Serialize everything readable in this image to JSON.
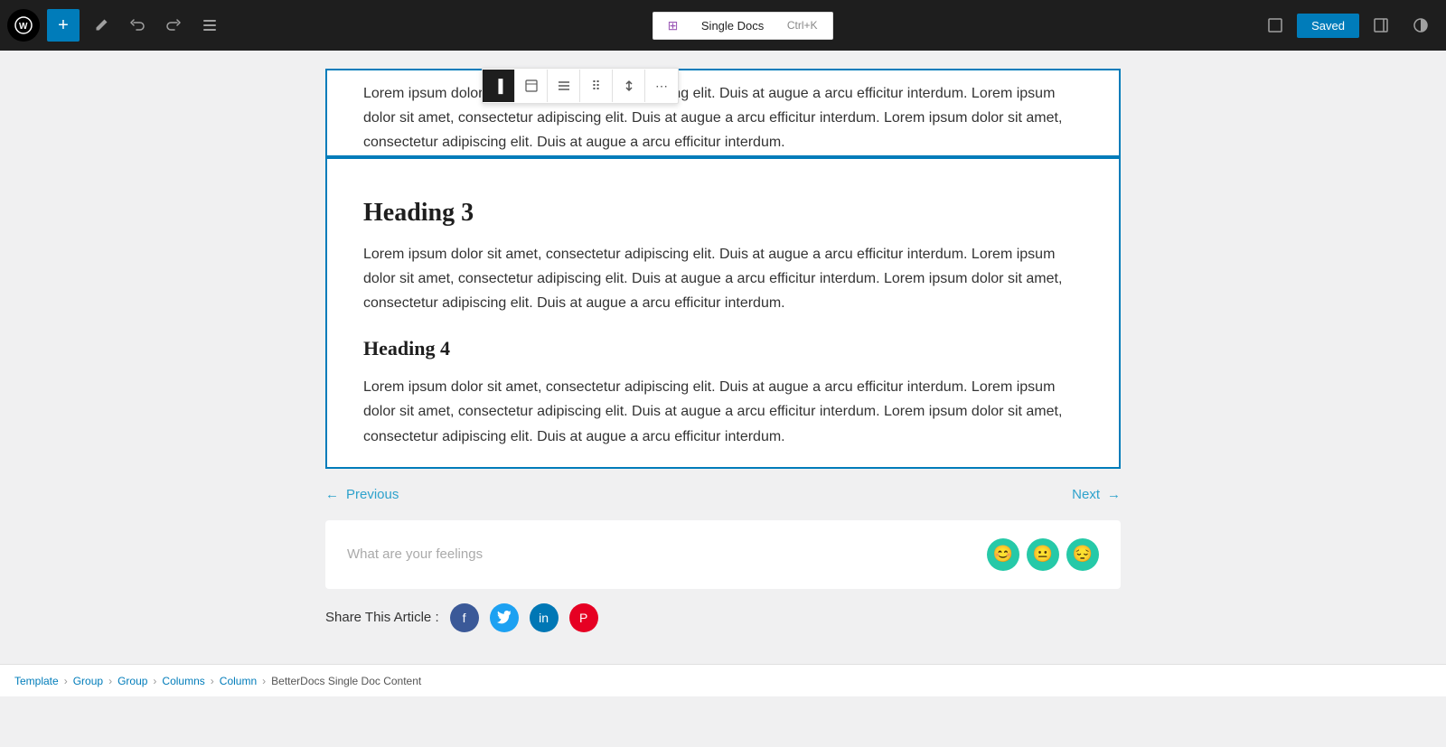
{
  "toolbar": {
    "add_block_label": "+",
    "edit_label": "✏",
    "undo_label": "←",
    "redo_label": "→",
    "list_view_label": "≡",
    "single_docs_label": "Single Docs",
    "shortcut_label": "Ctrl+K",
    "saved_label": "Saved",
    "view_icon": "▭",
    "sidebar_icon": "▣",
    "contrast_icon": "◑"
  },
  "block_toolbar": {
    "sidebar_btn": "▐",
    "block_type": "B",
    "align_btn": "≡",
    "drag_btn": "⠿",
    "move_btn": "⇅",
    "more_btn": "⋯"
  },
  "content": {
    "top_paragraph": "Lorem ipsum dolor sit amet, consectetur adipiscing elit. Duis at augue a arcu efficitur interdum. Lorem ipsum dolor sit amet, consectetur adipiscing elit. Duis at augue a arcu efficitur interdum. Lorem ipsum dolor sit amet, consectetur adipiscing elit. Duis at augue a arcu efficitur interdum.",
    "heading3": "Heading 3",
    "para3": "Lorem ipsum dolor sit amet, consectetur adipiscing elit. Duis at augue a arcu efficitur interdum. Lorem ipsum dolor sit amet, consectetur adipiscing elit. Duis at augue a arcu efficitur interdum. Lorem ipsum dolor sit amet, consectetur adipiscing elit. Duis at augue a arcu efficitur interdum.",
    "heading4": "Heading 4",
    "para4": "Lorem ipsum dolor sit amet, consectetur adipiscing elit. Duis at augue a arcu efficitur interdum. Lorem ipsum dolor sit amet, consectetur adipiscing elit. Duis at augue a arcu efficitur interdum. Lorem ipsum dolor sit amet, consectetur adipiscing elit. Duis at augue a arcu efficitur interdum."
  },
  "navigation": {
    "previous_label": "← Previous",
    "next_label": "Next →"
  },
  "feelings": {
    "placeholder": "What are your feelings",
    "icons": [
      "😊",
      "😐",
      "😔"
    ]
  },
  "share": {
    "label": "Share This Article :",
    "platforms": [
      "f",
      "t",
      "in",
      "P"
    ]
  },
  "breadcrumb": {
    "items": [
      "Template",
      "Group",
      "Group",
      "Columns",
      "Column",
      "BetterDocs Single Doc Content"
    ]
  },
  "colors": {
    "accent": "#007cba",
    "teal": "#26c9a8"
  }
}
